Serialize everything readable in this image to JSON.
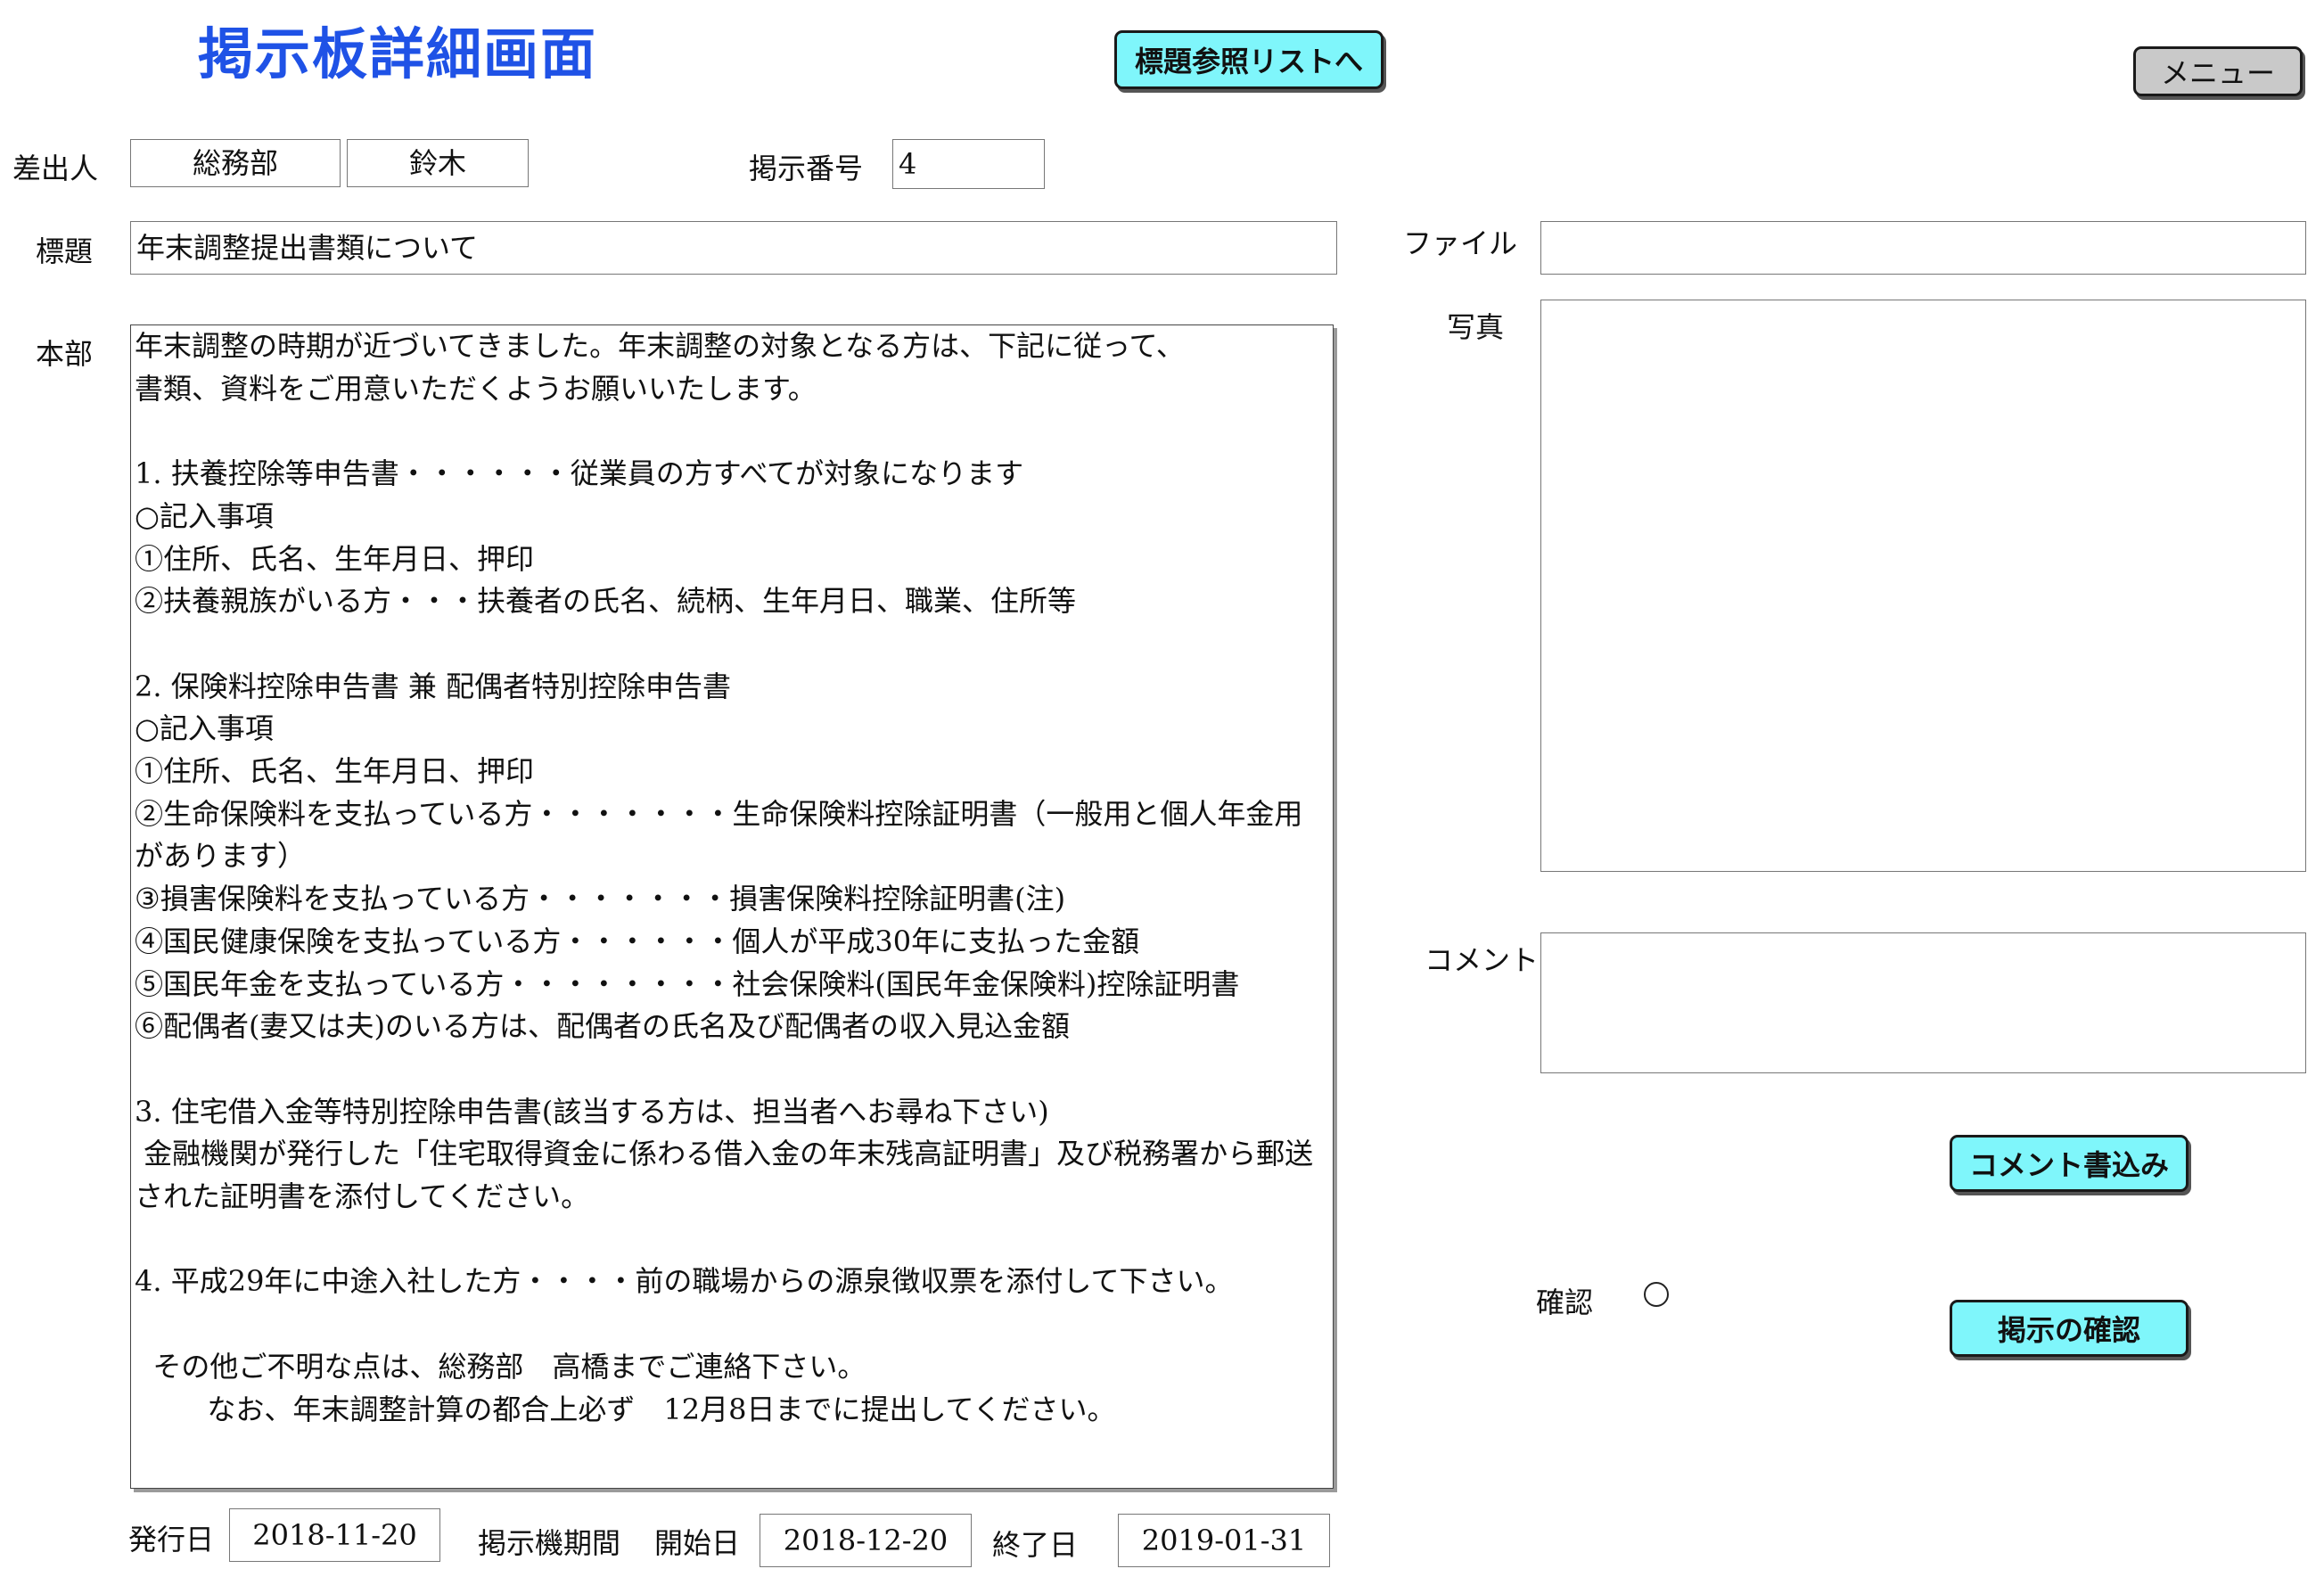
{
  "header": {
    "title": "掲示板詳細画面",
    "title_list_button": "標題参照リストへ",
    "menu_button": "メニュー"
  },
  "sender": {
    "label": "差出人",
    "department": "総務部",
    "name": "鈴木"
  },
  "post_number": {
    "label": "掲示番号",
    "value": "4"
  },
  "subject": {
    "label": "標題",
    "value": "年末調整提出書類について"
  },
  "body": {
    "label": "本部",
    "text": "年末調整の時期が近づいてきました。年末調整の対象となる方は、下記に従って、\n書類、資料をご用意いただくようお願いいたします。\n\n1. 扶養控除等申告書・・・・・・従業員の方すべてが対象になります\n○記入事項\n①住所、氏名、生年月日、押印\n②扶養親族がいる方・・・扶養者の氏名、続柄、生年月日、職業、住所等\n\n2. 保険料控除申告書 兼 配偶者特別控除申告書\n○記入事項\n①住所、氏名、生年月日、押印\n②生命保険料を支払っている方・・・・・・・生命保険料控除証明書（一般用と個人年金用があります）\n③損害保険料を支払っている方・・・・・・・損害保険料控除証明書(注)\n④国民健康保険を支払っている方・・・・・・個人が平成30年に支払った金額\n⑤国民年金を支払っている方・・・・・・・・社会保険料(国民年金保険料)控除証明書\n⑥配偶者(妻又は夫)のいる方は、配偶者の氏名及び配偶者の収入見込金額\n\n3. 住宅借入金等特別控除申告書(該当する方は、担当者へお尋ね下さい)\n 金融機関が発行した「住宅取得資金に係わる借入金の年末残高証明書」及び税務署から郵送された証明書を添付してください。\n\n4. 平成29年に中途入社した方・・・・前の職場からの源泉徴収票を添付して下さい。\n\n  その他ご不明な点は、総務部　高橋までご連絡下さい。\n        なお、年末調整計算の都合上必ず　12月8日までに提出してください。"
  },
  "file": {
    "label": "ファイル",
    "value": ""
  },
  "photo": {
    "label": "写真"
  },
  "comment": {
    "label": "コメント",
    "value": "",
    "write_button": "コメント書込み"
  },
  "confirm": {
    "label": "確認",
    "checked": false,
    "confirm_button": "掲示の確認"
  },
  "dates": {
    "issue_label": "発行日",
    "issue_date": "2018-11-20",
    "period_label": "掲示機期間",
    "start_label": "開始日",
    "start_date": "2018-12-20",
    "end_label": "終了日",
    "end_date": "2019-01-31"
  },
  "colors": {
    "title": "#1f52e6",
    "button_cyan": "#7ff6fb",
    "button_gray": "#c9c9c9"
  }
}
